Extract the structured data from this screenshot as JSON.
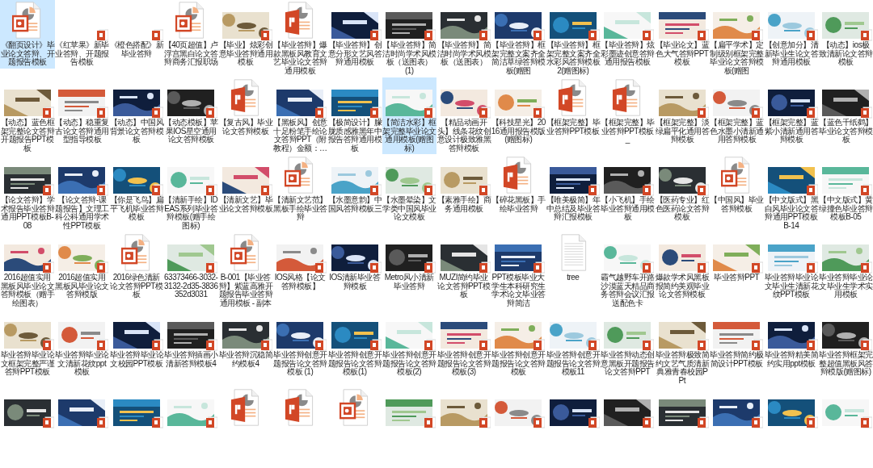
{
  "files": [
    {
      "name": "《翻页设计》毕业论文答辩、开题报告模板",
      "kind": "outline",
      "selected": true
    },
    {
      "name": "《红苹果》新毕业答辩、开题报告模板",
      "kind": "blank",
      "selected": false
    },
    {
      "name": "《橙色搭配》新毕业答辩",
      "kind": "blank",
      "selected": false
    },
    {
      "name": "【40页超值】卢浮宫黑白论文答辩商务汇报职场",
      "kind": "outline",
      "selected": false
    },
    {
      "name": "【毕业】炫彩创意毕业答辩通用模板",
      "kind": "slide",
      "selected": false
    },
    {
      "name": "【毕业答辩】爆款黑板风教育文艺毕业论文答辩通用模板",
      "kind": "file",
      "selected": false
    },
    {
      "name": "【毕业答辩】创意分形文艺风答辩通用模板",
      "kind": "slide",
      "selected": false
    },
    {
      "name": "【毕业答辩】简洁时尚学术风模板（送图表）(1)",
      "kind": "slide",
      "selected": false
    },
    {
      "name": "【毕业答辩】简洁时尚学术风模板（送图表）",
      "kind": "slide",
      "selected": false
    },
    {
      "name": "【毕业答辩】框架完整文案齐全简洁草绿答辩模板(赠图",
      "kind": "slide",
      "selected": false
    },
    {
      "name": "【毕业答辩】框架完整文案齐全水彩风答辩模板2(赠图标)",
      "kind": "slide",
      "selected": false
    },
    {
      "name": "【毕业答辩】炫彩墨迹创意答辩通用报告模板",
      "kind": "slide",
      "selected": false
    },
    {
      "name": "【毕业论文】蓝色大气答辩PPT模板",
      "kind": "slide",
      "selected": false
    },
    {
      "name": "【扁平学术】定制级别框架完整毕业论文答辩模板(赠图",
      "kind": "slide",
      "selected": false
    },
    {
      "name": "【创意加分】清新毕业生论文答辩通用模板",
      "kind": "slide",
      "selected": false
    },
    {
      "name": "【动态】ios极致清新论文答辩模板",
      "kind": "slide",
      "selected": false
    },
    {
      "name": "【动态】蓝色框架完整论文答辩开题报告PPT模板",
      "kind": "slide",
      "selected": false
    },
    {
      "name": "【动态】稳重复古论文答辩通用型指导模板",
      "kind": "slide",
      "selected": false
    },
    {
      "name": "【动态】中国风背景论文答辩模板",
      "kind": "slide",
      "selected": false
    },
    {
      "name": "【动态模板】苹果IOS星空通用论文答辩模板",
      "kind": "slide",
      "selected": false
    },
    {
      "name": "【复古风】毕业论文答辩模板",
      "kind": "file",
      "selected": false
    },
    {
      "name": "【黑板风】创意十足粉笔手绘论文答辩PPT（附教程）金额：…",
      "kind": "slide",
      "selected": false
    },
    {
      "name": "【极简设计】朦胧质感雅黑年中报告答辩通用模板",
      "kind": "slide",
      "selected": false
    },
    {
      "name": "【简洁水彩】框架完整毕业论文通用模板(赠图标)",
      "kind": "slide",
      "selected": true
    },
    {
      "name": "【精品动画开头】线条花纹创意设计极致雅黑答辩模板",
      "kind": "slide",
      "selected": false
    },
    {
      "name": "【科技星光】2016通用报告模版(赠图标)",
      "kind": "slide",
      "selected": false
    },
    {
      "name": "【框架完整】毕业答辩PPT模板",
      "kind": "file",
      "selected": false
    },
    {
      "name": "【框架完整】毕业答辩PPT模板_",
      "kind": "file",
      "selected": false
    },
    {
      "name": "【框架完整】淡绿扁平化通用答辩模板",
      "kind": "slide",
      "selected": false
    },
    {
      "name": "【框架完整】蓝色水墨小清新通用答辩模板",
      "kind": "slide",
      "selected": false
    },
    {
      "name": "【框架完整】蓝紫小清新通用答辩模板",
      "kind": "slide",
      "selected": false
    },
    {
      "name": "【蓝色千纸鹤】毕业论文答辩模板",
      "kind": "slide",
      "selected": false
    },
    {
      "name": "【论文答辩】学术报告毕业答辩通用PPT模板B-08",
      "kind": "slide",
      "selected": false
    },
    {
      "name": "【论文答辩-课题报告】文理工科公科通用学术性PPT模板",
      "kind": "slide",
      "selected": false
    },
    {
      "name": "【你是飞鸟】扁平飞机毕业答辩模板",
      "kind": "slide",
      "selected": false
    },
    {
      "name": "【清新手绘】IDEAS系列毕业答辩模板(赠手绘图标)",
      "kind": "slide",
      "selected": false
    },
    {
      "name": "【清新文艺】毕业论文答辩模板",
      "kind": "slide",
      "selected": false
    },
    {
      "name": "【清新文艺范】黑板手绘毕业答辩",
      "kind": "outline",
      "selected": false
    },
    {
      "name": "【水墨意韵】中国风答辩模板三",
      "kind": "slide",
      "selected": false
    },
    {
      "name": "【水墨晕染】文学类中国风毕业论文模板",
      "kind": "slide",
      "selected": false
    },
    {
      "name": "【素雅手绘】商务通用模板",
      "kind": "slide",
      "selected": false
    },
    {
      "name": "【碎花黑板】手绘毕业答辩",
      "kind": "file",
      "selected": false
    },
    {
      "name": "【唯美极简】年中总结及毕业答辩汇报模板",
      "kind": "slide",
      "selected": false
    },
    {
      "name": "【小飞机】手绘毕业答辩通用模板",
      "kind": "slide",
      "selected": false
    },
    {
      "name": "【医药专业】红色医药论文答辩模板",
      "kind": "slide",
      "selected": false
    },
    {
      "name": "【中国风】毕业答辩模板",
      "kind": "outline",
      "selected": false
    },
    {
      "name": "【中文版式】黑白风毕业论文答辩通用PPT模板B-14",
      "kind": "slide",
      "selected": false
    },
    {
      "name": "【中文版式】黄绿撞色毕业答辩模板B-05",
      "kind": "slide",
      "selected": false
    },
    {
      "name": "2016超值实用黑板风毕业论文答辩模板（赠手绘图表）",
      "kind": "slide",
      "selected": false
    },
    {
      "name": "2016超值实用黑板风毕业论文答辩模版",
      "kind": "slide",
      "selected": false
    },
    {
      "name": "2016绿色清新论文答辩PPT模板",
      "kind": "outline",
      "selected": false
    },
    {
      "name": "63373466-3032-3132-2d35-3836352d3031",
      "kind": "slide",
      "selected": false
    },
    {
      "name": "B-001【毕业答辩】紫蓝高雅开题报告毕业答辩通用模板 - 副本",
      "kind": "outline",
      "selected": false
    },
    {
      "name": "IOS风格【论文答辩模板】",
      "kind": "slide",
      "selected": false
    },
    {
      "name": "IOS清新毕业答辩模板",
      "kind": "slide",
      "selected": false
    },
    {
      "name": "Metro风小清新毕业答辩",
      "kind": "slide",
      "selected": false
    },
    {
      "name": "MUZI简约毕业论文答辩PPT模板",
      "kind": "slide",
      "selected": false
    },
    {
      "name": "PPT模板毕业大学生本科研究生学术论文毕业答辩简洁",
      "kind": "slide",
      "selected": false
    },
    {
      "name": "tree",
      "kind": "text",
      "selected": false
    },
    {
      "name": "霸气越野车开路沙漠蓝天精品商务答辩会议汇报送配色卡",
      "kind": "slide",
      "selected": false
    },
    {
      "name": "爆款学术风黑板报简约美观毕业论文答辩模板",
      "kind": "slide",
      "selected": false
    },
    {
      "name": "毕业答辩PPT",
      "kind": "slide",
      "selected": false
    },
    {
      "name": "毕业答辩毕业论文毕业生清新花纹PPT模板",
      "kind": "slide",
      "selected": false
    },
    {
      "name": "毕业答辩毕业论文毕业生学术实用模板",
      "kind": "slide",
      "selected": false
    },
    {
      "name": "毕业答辩毕业论文框架完整严谨答辩PPT模板",
      "kind": "slide",
      "selected": false
    },
    {
      "name": "毕业答辩毕业论文清新花纹ppt模板",
      "kind": "slide",
      "selected": false
    },
    {
      "name": "毕业答辩毕业论文校园PPT模板",
      "kind": "slide",
      "selected": false
    },
    {
      "name": "毕业答辩插画小清新答辩模板4",
      "kind": "slide",
      "selected": false
    },
    {
      "name": "毕业答辩沉稳简约模板4",
      "kind": "slide",
      "selected": false
    },
    {
      "name": "毕业答辩创意开题报告论文答辩模板 (1)",
      "kind": "slide",
      "selected": false
    },
    {
      "name": "毕业答辩创意开题报告论文答辩模板(1)",
      "kind": "slide",
      "selected": false
    },
    {
      "name": "毕业答辩创意开题报告论文答辩模板(2)",
      "kind": "slide",
      "selected": false
    },
    {
      "name": "毕业答辩创意开题报告论文答辩模板(3)",
      "kind": "slide",
      "selected": false
    },
    {
      "name": "毕业答辩创意开题报告论文答辩模板",
      "kind": "slide",
      "selected": false
    },
    {
      "name": "毕业答辩创意开题报告论文答辩模板11",
      "kind": "slide",
      "selected": false
    },
    {
      "name": "毕业答辩动态创意黑板开题报告论文答辩PPT",
      "kind": "slide",
      "selected": false
    },
    {
      "name": "毕业答辩极致简约文艺气质清新典雅青春校园PPt",
      "kind": "slide",
      "selected": false
    },
    {
      "name": "毕业答辩简约极简设计PPT模板",
      "kind": "slide",
      "selected": false
    },
    {
      "name": "毕业答辩精美简约实用ppt模板",
      "kind": "slide",
      "selected": false
    },
    {
      "name": "毕业答辩框架完整超值黑板风答辩模版(赠图标)",
      "kind": "slide",
      "selected": false
    },
    {
      "kind": "slide",
      "selected": false
    },
    {
      "kind": "slide",
      "selected": false
    },
    {
      "kind": "slide",
      "selected": false
    },
    {
      "kind": "slide",
      "selected": false
    },
    {
      "kind": "file",
      "selected": false
    },
    {
      "kind": "file",
      "selected": false
    },
    {
      "kind": "outline",
      "selected": false
    },
    {
      "kind": "slide",
      "selected": false
    },
    {
      "kind": "slide",
      "selected": false
    },
    {
      "kind": "slide",
      "selected": false
    },
    {
      "kind": "slide",
      "selected": false
    },
    {
      "kind": "slide",
      "selected": false
    },
    {
      "kind": "slide",
      "selected": false
    },
    {
      "kind": "slide",
      "selected": false
    },
    {
      "kind": "slide",
      "selected": false
    },
    {
      "kind": "slide",
      "selected": false
    }
  ]
}
